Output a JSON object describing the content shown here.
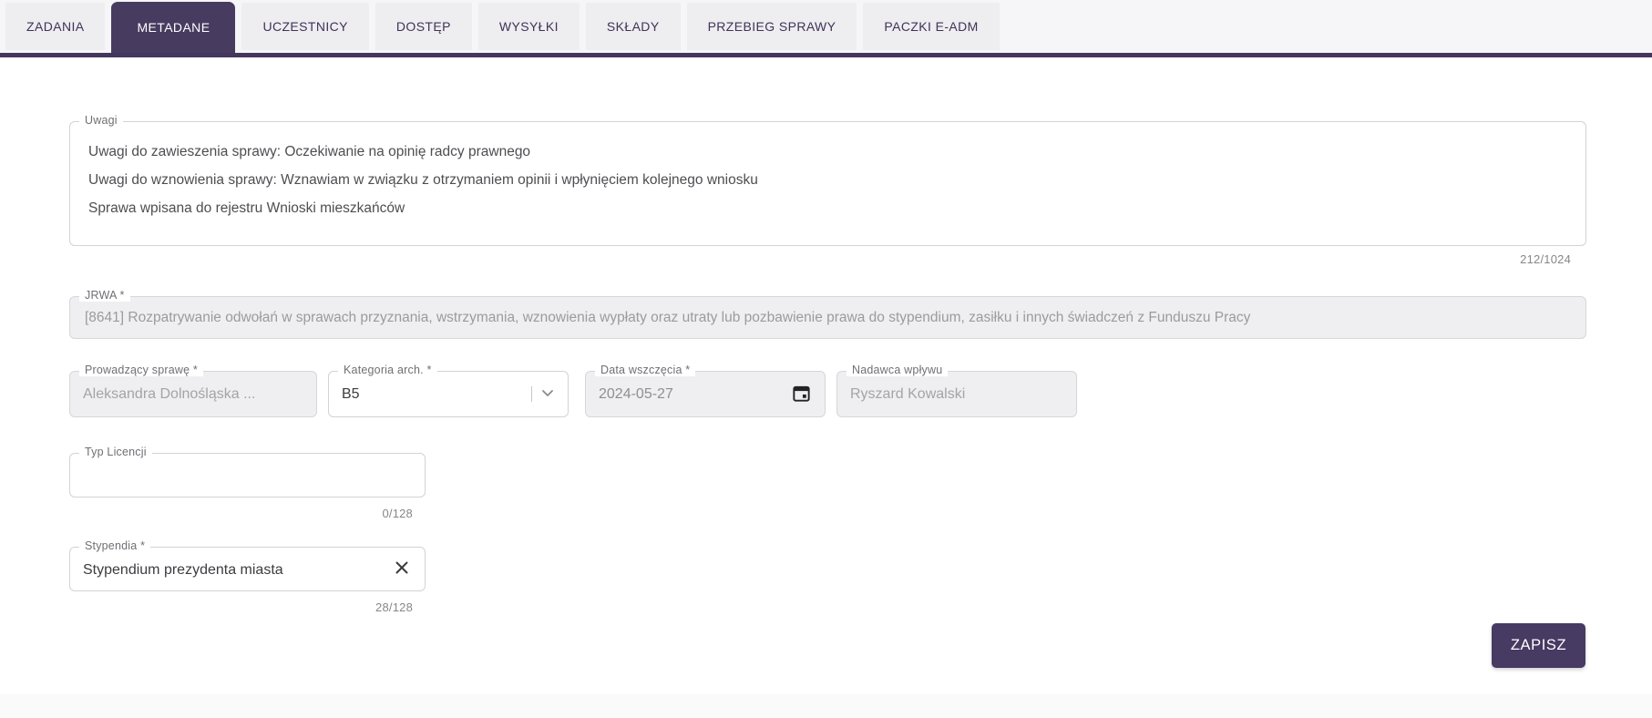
{
  "tabs": {
    "items": [
      {
        "label": "ZADANIA",
        "active": false
      },
      {
        "label": "METADANE",
        "active": true
      },
      {
        "label": "UCZESTNICY",
        "active": false
      },
      {
        "label": "DOSTĘP",
        "active": false
      },
      {
        "label": "WYSYŁKI",
        "active": false
      },
      {
        "label": "SKŁADY",
        "active": false
      },
      {
        "label": "PRZEBIEG SPRAWY",
        "active": false
      },
      {
        "label": "PACZKI E-ADM",
        "active": false
      }
    ]
  },
  "form": {
    "uwagi": {
      "label": "Uwagi",
      "lines": [
        "Uwagi do zawieszenia sprawy: Oczekiwanie na opinię radcy prawnego",
        "Uwagi do wznowienia sprawy: Wznawiam w związku z otrzymaniem opinii i wpłynięciem kolejnego wniosku",
        "Sprawa wpisana do rejestru Wnioski mieszkańców"
      ],
      "counter": "212/1024"
    },
    "jrwa": {
      "label": "JRWA *",
      "value": "[8641] Rozpatrywanie odwołań w sprawach przyznania, wstrzymania, wznowienia wypłaty oraz utraty lub pozbawienie prawa do stypendium, zasiłku i innych świadczeń z Funduszu Pracy",
      "disabled": true
    },
    "prowadzacy_sprawe": {
      "label": "Prowadzący sprawę *",
      "value": "Aleksandra Dolnośląska ...",
      "disabled": true
    },
    "kategoria_arch": {
      "label": "Kategoria arch. *",
      "value": "B5",
      "disabled": false
    },
    "data_wszczecia": {
      "label": "Data wszczęcia *",
      "value": "2024-05-27"
    },
    "nadawca_wplywu": {
      "label": "Nadawca wpływu",
      "value": "Ryszard Kowalski",
      "disabled": true
    },
    "typ_licencji": {
      "label": "Typ Licencji",
      "value": "",
      "counter": "0/128"
    },
    "stypendia": {
      "label": "Stypendia *",
      "value": "Stypendium prezydenta miasta",
      "counter": "28/128"
    }
  },
  "actions": {
    "save_label": "ZAPISZ"
  },
  "icons": {
    "kategoria_dropdown": "chevron-down-icon",
    "data_picker": "calendar-icon",
    "stypendia_clear": "clear-icon"
  },
  "colors": {
    "accent_purple": "#473b60",
    "tab_underline": "#44365c",
    "disabled_field_bg": "#efeff1",
    "field_border": "#d3d3d8",
    "inactive_tab_bg": "#eeedf0",
    "text_dark": "#3c3c40",
    "text_disabled": "#a4a4a8",
    "counter_text": "#87878b"
  }
}
